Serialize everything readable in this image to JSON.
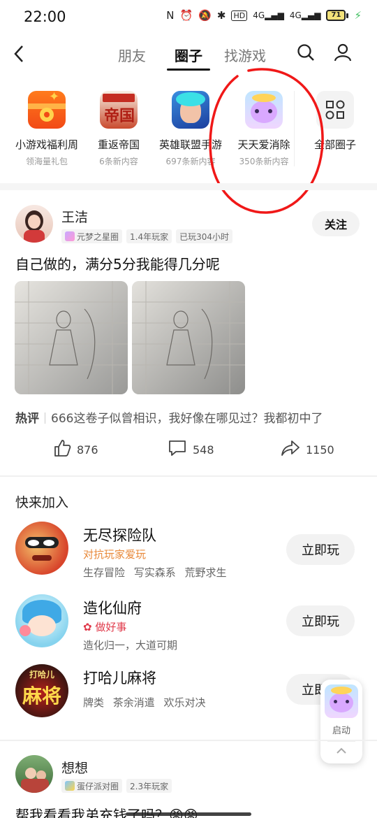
{
  "status_bar": {
    "time": "22:00",
    "network": "4G",
    "battery": "71"
  },
  "nav": {
    "tabs": [
      {
        "label": "朋友",
        "active": false
      },
      {
        "label": "圈子",
        "active": true
      },
      {
        "label": "找游戏",
        "active": false
      }
    ]
  },
  "circles": [
    {
      "name": "小游戏福利周",
      "sub": "领海量礼包",
      "icon": "gift-box-icon"
    },
    {
      "name": "重返帝国",
      "sub": "6条新内容",
      "icon": "empire-game-icon"
    },
    {
      "name": "英雄联盟手游",
      "sub": "697条新内容",
      "icon": "lol-game-icon"
    },
    {
      "name": "天天爱消除",
      "sub": "350条新内容",
      "icon": "cat-game-icon"
    },
    {
      "name": "全部圈子",
      "sub": "",
      "icon": "all-circles-icon"
    }
  ],
  "post": {
    "author": "王洁",
    "tags": [
      "元梦之星圈",
      "1.4年玩家",
      "已玩304小时"
    ],
    "follow_label": "关注",
    "text": "自己做的，满分5分我能得几分呢",
    "hot_label": "热评",
    "hot_comment": "666这卷子似曾相识，我好像在哪见过？我都初中了",
    "likes": "876",
    "comments": "548",
    "shares": "1150"
  },
  "join": {
    "title": "快来加入",
    "games": [
      {
        "name": "无尽探险队",
        "sub": "对抗玩家爱玩",
        "sub_color": "#e8893a",
        "tags": "生存冒险 写实森系 荒野求生",
        "button": "立即玩"
      },
      {
        "name": "造化仙府",
        "sub": "做好事",
        "sub_color": "#e0394a",
        "tags": "造化归一，大道可期",
        "button": "立即玩"
      },
      {
        "name": "打哈儿麻将",
        "sub": "",
        "sub_color": "",
        "tags": "牌类 茶余消遣 欢乐对决",
        "button": "立即玩"
      }
    ]
  },
  "floating": {
    "label": "启动"
  },
  "post2": {
    "author": "想想",
    "tags": [
      "蛋仔派对圈",
      "2.3年玩家"
    ],
    "text": "帮我看看我弟充钱了吗？😡😡"
  }
}
